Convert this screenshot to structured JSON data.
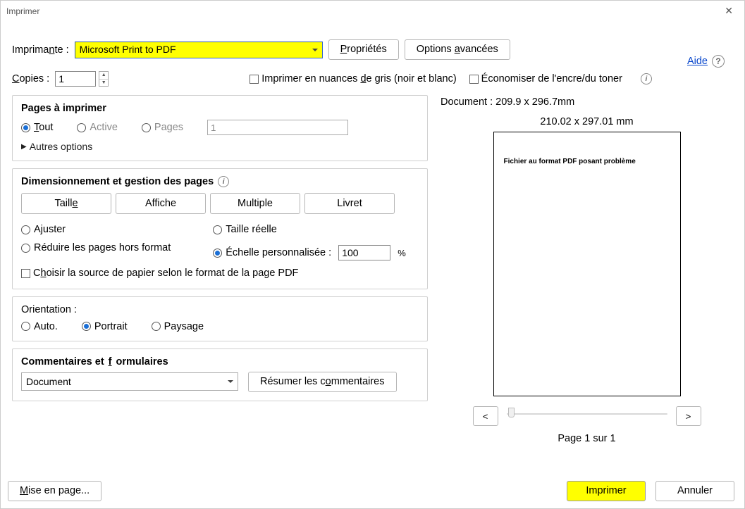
{
  "title": "Imprimer",
  "help": {
    "label": "Aide"
  },
  "printer": {
    "label": "Imprimante :",
    "value": "Microsoft Print to PDF"
  },
  "buttons": {
    "properties": "Propriétés",
    "advanced": "Options avancées",
    "page_setup": "Mise en page...",
    "print": "Imprimer",
    "cancel": "Annuler",
    "summarize_comments": "Résumer les commentaires"
  },
  "copies": {
    "label": "Copies :",
    "value": "1"
  },
  "checkboxes": {
    "grayscale": "Imprimer en nuances de gris (noir et blanc)",
    "save_ink": "Économiser de l'encre/du toner",
    "paper_source": "Choisir la source de papier selon le format de la page PDF"
  },
  "pages_panel": {
    "title": "Pages à imprimer",
    "all": "Tout",
    "active": "Active",
    "pages": "Pages",
    "pages_value": "1",
    "more_options": "Autres options"
  },
  "sizing_panel": {
    "title": "Dimensionnement et gestion des pages",
    "tabs": {
      "size": "Taille",
      "poster": "Affiche",
      "multiple": "Multiple",
      "booklet": "Livret"
    },
    "fit": "Ajuster",
    "actual": "Taille réelle",
    "shrink": "Réduire les pages hors format",
    "custom_scale": "Échelle personnalisée :",
    "scale_value": "100",
    "scale_pct": "%"
  },
  "orientation": {
    "title": "Orientation :",
    "auto": "Auto.",
    "portrait": "Portrait",
    "landscape": "Paysage"
  },
  "comments_panel": {
    "title": "Commentaires et formulaires",
    "value": "Document"
  },
  "preview": {
    "doc_label": "Document : 209.9 x 296.7mm",
    "page_size": "210.02 x 297.01 mm",
    "page_text": "Fichier au format PDF posant problème",
    "page_n": "Page 1 sur 1",
    "prev": "<",
    "next": ">"
  }
}
